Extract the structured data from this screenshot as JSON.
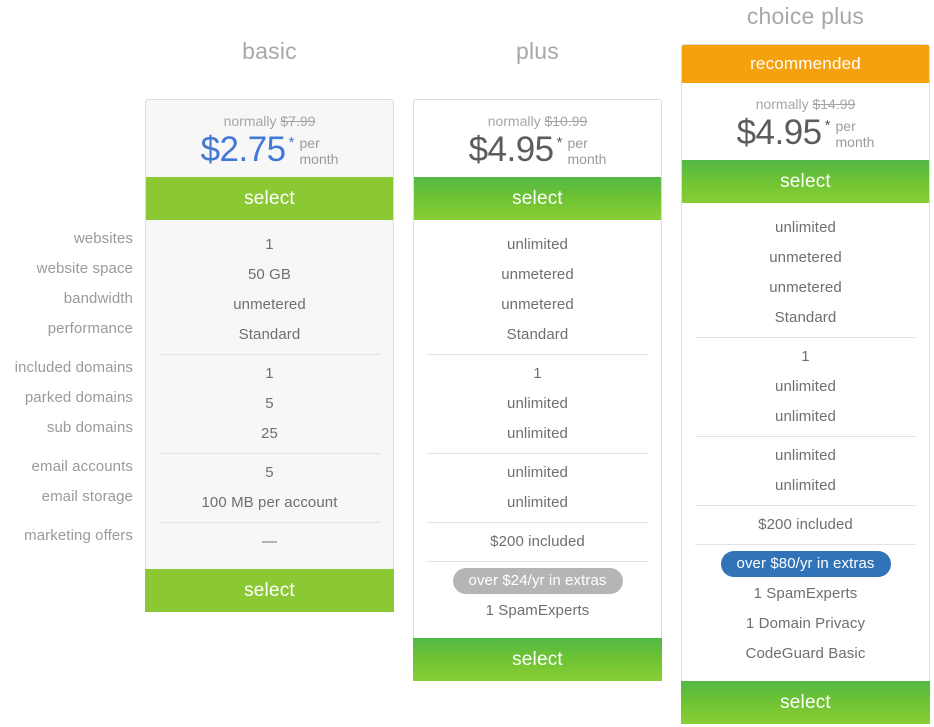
{
  "feature_labels": [
    "websites",
    "website space",
    "bandwidth",
    "performance",
    "included domains",
    "parked domains",
    "sub domains",
    "email accounts",
    "email storage",
    "marketing offers"
  ],
  "colors": {
    "price_highlight": "#4478d6",
    "select_flat": "#8bc934",
    "select_gradient_top": "#53b847",
    "recommended_banner": "#f5a00d",
    "pill_gray": "#b5b5b5",
    "pill_blue": "#3073b8",
    "card_tint": "#f7f7f7"
  },
  "plans": [
    {
      "id": "basic",
      "title": "basic",
      "recommended_label": "",
      "normally_prefix": "normally",
      "normally_price": "$7.99",
      "price": "$2.75",
      "asterisk": "*",
      "per_month": "per\nmonth",
      "select_label": "select",
      "bottom_select_label": "select",
      "groups": [
        {
          "values": [
            "1",
            "50 GB",
            "unmetered",
            "Standard"
          ]
        },
        {
          "values": [
            "1",
            "5",
            "25"
          ]
        },
        {
          "values": [
            "5",
            "100 MB per account"
          ]
        },
        {
          "values": [
            "—"
          ]
        }
      ],
      "badge": "",
      "extras": []
    },
    {
      "id": "plus",
      "title": "plus",
      "recommended_label": "",
      "normally_prefix": "normally",
      "normally_price": "$10.99",
      "price": "$4.95",
      "asterisk": "*",
      "per_month": "per\nmonth",
      "select_label": "select",
      "bottom_select_label": "select",
      "groups": [
        {
          "values": [
            "unlimited",
            "unmetered",
            "unmetered",
            "Standard"
          ]
        },
        {
          "values": [
            "1",
            "unlimited",
            "unlimited"
          ]
        },
        {
          "values": [
            "unlimited",
            "unlimited"
          ]
        },
        {
          "values": [
            "$200 included"
          ]
        }
      ],
      "badge": "over $24/yr in extras",
      "extras": [
        "1 SpamExperts"
      ]
    },
    {
      "id": "choice-plus",
      "title": "choice plus",
      "recommended_label": "recommended",
      "normally_prefix": "normally",
      "normally_price": "$14.99",
      "price": "$4.95",
      "asterisk": "*",
      "per_month": "per\nmonth",
      "select_label": "select",
      "bottom_select_label": "select",
      "groups": [
        {
          "values": [
            "unlimited",
            "unmetered",
            "unmetered",
            "Standard"
          ]
        },
        {
          "values": [
            "1",
            "unlimited",
            "unlimited"
          ]
        },
        {
          "values": [
            "unlimited",
            "unlimited"
          ]
        },
        {
          "values": [
            "$200 included"
          ]
        }
      ],
      "badge": "over $80/yr in extras",
      "extras": [
        "1 SpamExperts",
        "1 Domain Privacy",
        "CodeGuard Basic"
      ]
    }
  ]
}
